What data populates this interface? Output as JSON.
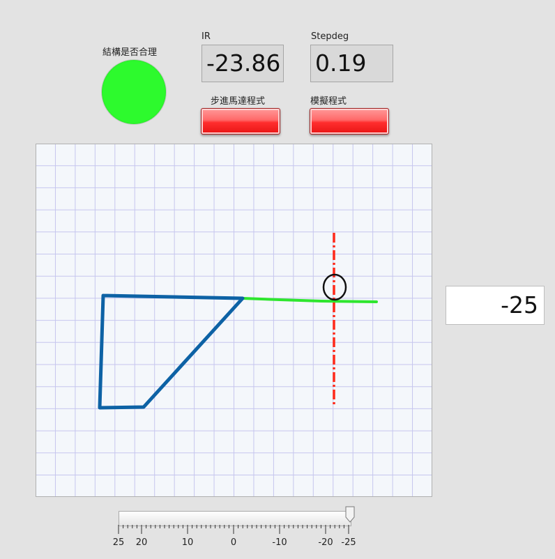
{
  "led": {
    "label": "結構是否合理",
    "color": "#2dfa2d"
  },
  "ir": {
    "label": "IR",
    "value": "-23.86"
  },
  "stepdeg": {
    "label": "Stepdeg",
    "value": "0.19"
  },
  "buttons": {
    "stepper_label": "步進馬達程式",
    "sim_label": "模擬程式"
  },
  "numeric_value": "-25",
  "slider": {
    "value": -25,
    "ticks": [
      "25",
      "20",
      "10",
      "0",
      "-10",
      "-20",
      "-25"
    ]
  },
  "colors": {
    "linkage": "#0d62a5",
    "trace": "#2ee62e",
    "target_line": "#ff2a1a",
    "indicator_on": "#2dfa2d",
    "button": "#ff3b3b"
  }
}
